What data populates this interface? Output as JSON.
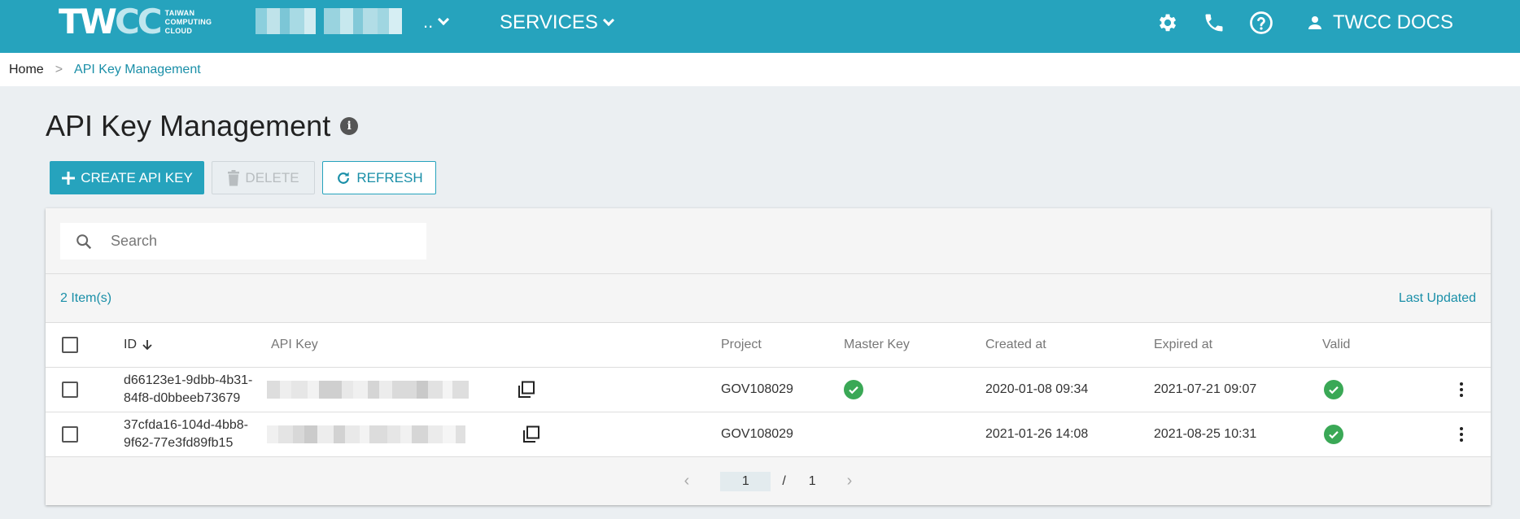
{
  "header": {
    "logo_main": "TW",
    "logo_main_cc": "CC",
    "logo_sub": [
      "TAIWAN",
      "COMPUTING",
      "CLOUD"
    ],
    "project_suffix": "..",
    "services_label": "SERVICES",
    "docs_label": "TWCC DOCS",
    "icons": [
      "gear-icon",
      "phone-icon",
      "help-icon",
      "user-icon"
    ],
    "bar_color": "#26a3bd"
  },
  "breadcrumb": {
    "home": "Home",
    "separator": ">",
    "current": "API Key Management"
  },
  "page": {
    "title": "API Key Management",
    "info_glyph": "i"
  },
  "toolbar": {
    "create_label": "CREATE API KEY",
    "delete_label": "DELETE",
    "refresh_label": "REFRESH"
  },
  "search": {
    "placeholder": "Search",
    "value": ""
  },
  "list": {
    "count_label": "2 Item(s)",
    "last_updated_label": "Last Updated"
  },
  "table": {
    "columns": {
      "id": "ID",
      "api_key": "API Key",
      "project": "Project",
      "master_key": "Master Key",
      "created_at": "Created at",
      "expired_at": "Expired at",
      "valid": "Valid"
    },
    "sort": {
      "column": "ID",
      "direction": "desc"
    },
    "rows": [
      {
        "id_line1": "d66123e1-9dbb-4b31-",
        "id_line2": "84f8-d0bbeeb73679",
        "project": "GOV108029",
        "master_key": true,
        "created_at": "2020-01-08 09:34",
        "expired_at": "2021-07-21 09:07",
        "valid": true
      },
      {
        "id_line1": "37cfda16-104d-4bb8-",
        "id_line2": "9f62-77e3fd89fb15",
        "project": "GOV108029",
        "master_key": false,
        "created_at": "2021-01-26 14:08",
        "expired_at": "2021-08-25 10:31",
        "valid": true
      }
    ]
  },
  "pagination": {
    "current_page": "1",
    "separator": "/",
    "total_pages": "1"
  },
  "colors": {
    "accent": "#26a3bd",
    "link": "#1a8fa8",
    "success": "#3aa856"
  }
}
